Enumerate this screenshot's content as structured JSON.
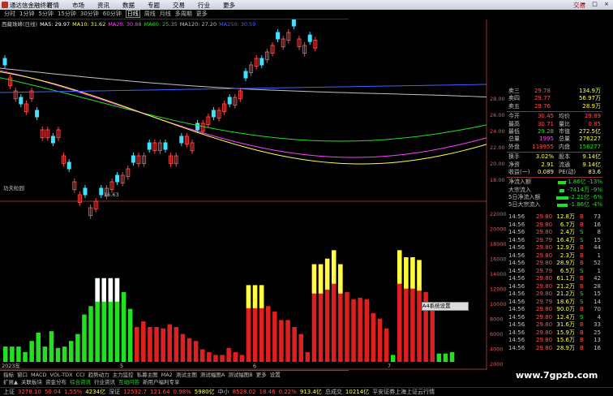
{
  "titlebar": {
    "app_title": "通达信金融终端",
    "menu": [
      "行情",
      "市场",
      "资讯",
      "数据",
      "专题",
      "交易",
      "行业",
      "更多"
    ],
    "brand": "交易",
    "win": "─ □ ×"
  },
  "periods": [
    "分时",
    "1分钟",
    "5分钟",
    "15分钟",
    "30分钟",
    "60分钟",
    "日线",
    "周线",
    "月线",
    "多周期",
    "更多"
  ],
  "active_period": "日线",
  "ma_info": [
    {
      "text": "西藏珠峰(日线)",
      "color": "#c0c0c0"
    },
    {
      "text": "MA5: 29.97",
      "color": "#ffffff"
    },
    {
      "text": "MA10: 31.62",
      "color": "#ffff40"
    },
    {
      "text": "MA20: 30.88",
      "color": "#ff40ff"
    },
    {
      "text": "MA60: 25.35",
      "color": "#20e020"
    },
    {
      "text": "MA120: 27.20",
      "color": "#c0c0c0"
    },
    {
      "text": "MA250: 30.59",
      "color": "#4060ff"
    }
  ],
  "price_axis": [
    "28.00",
    "26.00",
    "24.00",
    "22.00",
    "20.00",
    "18.00"
  ],
  "low_label": "16.63",
  "vol_axis": [
    "22000",
    "20000",
    "18000",
    "16000",
    "14000",
    "12000",
    "10000",
    "8000",
    "6000",
    "4000",
    "2000"
  ],
  "indicator_title": "功夫粒园",
  "date_labels": [
    "2023年",
    "5",
    "6",
    "7"
  ],
  "context_menu": "A4系统设置",
  "quote": {
    "rows_ask": [
      {
        "l": "卖三",
        "v1": "29.78",
        "v2": "134.9万"
      },
      {
        "l": "卖四",
        "v1": "29.77",
        "v2": "56.97万"
      },
      {
        "l": "卖五",
        "v1": "29.76",
        "v2": "28.9万"
      }
    ],
    "stats": [
      {
        "l": "今开",
        "v1": "30.45",
        "c1": "#ff5050",
        "l2": "均价",
        "v2": "29.89",
        "c2": "#ff5050"
      },
      {
        "l": "最高",
        "v1": "30.71",
        "c1": "#ff5050",
        "l2": "量比",
        "v2": "0.85",
        "c2": "#ff5050"
      },
      {
        "l": "最低",
        "v1": "29.28",
        "c1": "#20e020",
        "l2": "市值",
        "v2": "272.5亿",
        "c2": "#ffff40"
      },
      {
        "l": "总量",
        "v1": "1995",
        "c1": "#ff40ff",
        "l2": "总量",
        "v2": "276227",
        "c2": "#ffff40"
      },
      {
        "l": "外盘",
        "v1": "119955",
        "c1": "#ff5050",
        "l2": "内盘",
        "v2": "156277",
        "c2": "#20e020"
      }
    ],
    "stats2": [
      {
        "l": "换手",
        "v1": "3.02%",
        "c1": "#ffff40",
        "l2": "股本",
        "v2": "9.14亿",
        "c2": "#ffff40"
      },
      {
        "l": "净资",
        "v1": "2.91",
        "c1": "#ffff40",
        "l2": "流通",
        "v2": "9.14亿",
        "c2": "#ffff40"
      },
      {
        "l": "收益(一)",
        "v1": "0.089",
        "c1": "#ffff40",
        "l2": "PE(动)",
        "v2": "83.6",
        "c2": "#ffff40"
      }
    ],
    "flows": [
      {
        "l": "净流入额",
        "v2": "-1.86亿",
        "pct": "-13%",
        "bar": 0.2
      },
      {
        "l": "大宗流入",
        "v2": "-7414万",
        "pct": "-9%",
        "bar": 0.05
      },
      {
        "l": "5日净流入额",
        "v2": "-2.21亿",
        "pct": "-6%",
        "bar": 0.35
      },
      {
        "l": "5日大宗流入",
        "v2": "-1.86亿",
        "pct": "-4%",
        "bar": 0.3
      }
    ]
  },
  "ticks": [
    {
      "t": "14:56",
      "p": "29.80",
      "v": "12.8万",
      "bs": "B",
      "n": "73"
    },
    {
      "t": "14:56",
      "p": "29.80",
      "v": "6.7万",
      "bs": "B",
      "n": "16"
    },
    {
      "t": "14:56",
      "p": "29.80",
      "v": "2.4万",
      "bs": "S",
      "n": "8"
    },
    {
      "t": "14:56",
      "p": "29.79",
      "v": "16.4万",
      "bs": "S",
      "n": "15"
    },
    {
      "t": "14:56",
      "p": "29.80",
      "v": "12.9万",
      "bs": "B",
      "n": "44"
    },
    {
      "t": "14:56",
      "p": "29.80",
      "v": "2.3万",
      "bs": "B",
      "n": "1"
    },
    {
      "t": "14:56",
      "p": "29.80",
      "v": "28.9万",
      "bs": "B",
      "n": "52"
    },
    {
      "t": "14:56",
      "p": "29.79",
      "v": "6.5万",
      "bs": "S",
      "n": "1"
    },
    {
      "t": "14:56",
      "p": "29.80",
      "v": "61.1万",
      "bs": "B",
      "n": "42"
    },
    {
      "t": "14:56",
      "p": "29.80",
      "v": "21.2万",
      "bs": "B",
      "n": "28"
    },
    {
      "t": "14:56",
      "p": "29.80",
      "v": "21.2万",
      "bs": "S",
      "n": "15"
    },
    {
      "t": "14:56",
      "p": "29.79",
      "v": "18.6万",
      "bs": "S",
      "n": "14"
    },
    {
      "t": "14:56",
      "p": "29.80",
      "v": "90.0万",
      "bs": "B",
      "n": "70"
    },
    {
      "t": "14:56",
      "p": "29.80",
      "v": "12.4万",
      "bs": "S",
      "n": "4"
    },
    {
      "t": "14:56",
      "p": "29.80",
      "v": "31.6万",
      "bs": "B",
      "n": "33"
    },
    {
      "t": "14:56",
      "p": "29.80",
      "v": "15.9万",
      "bs": "B",
      "n": "25"
    },
    {
      "t": "14:56",
      "p": "29.80",
      "v": "15.6万",
      "bs": "B",
      "n": "13"
    },
    {
      "t": "14:56",
      "p": "29.80",
      "v": "28.9万",
      "bs": "B",
      "n": "16"
    }
  ],
  "bottom_tabs": [
    "指标",
    "窗口",
    "MACD",
    "VOL-TDX",
    "CCI",
    "趋势动力",
    "主力监控",
    "私募主图",
    "MA2",
    "测试主图",
    "测试幅图A",
    "测试幅图B",
    "更多",
    "设置"
  ],
  "func_tabs": [
    "扩展▲",
    "关联板块",
    "资金分布",
    "综合资讯",
    "行业资讯",
    "互动问答",
    "新用户福利专享"
  ],
  "status": [
    {
      "text": "上证",
      "c": "#c0c0c0"
    },
    {
      "text": "3278.10",
      "c": "#ff5050"
    },
    {
      "text": "50.04",
      "c": "#ff5050"
    },
    {
      "text": "1.55%",
      "c": "#ff5050"
    },
    {
      "text": "4234亿",
      "c": "#ffff40"
    },
    {
      "text": "深证",
      "c": "#c0c0c0"
    },
    {
      "text": "12532.7",
      "c": "#ff5050"
    },
    {
      "text": "121.64",
      "c": "#ff5050"
    },
    {
      "text": "0.98%",
      "c": "#ff5050"
    },
    {
      "text": "5980亿",
      "c": "#ffff40"
    },
    {
      "text": "中小",
      "c": "#c0c0c0"
    },
    {
      "text": "8528.02",
      "c": "#ff5050"
    },
    {
      "text": "18.46",
      "c": "#ff5050"
    },
    {
      "text": "0.22%",
      "c": "#ff5050"
    },
    {
      "text": "913.4亿",
      "c": "#ffff40"
    },
    {
      "text": "总成交",
      "c": "#c0c0c0"
    },
    {
      "text": "10214亿",
      "c": "#ffff40"
    },
    {
      "text": "平安证券上海上证云行情",
      "c": "#c0c0c0"
    }
  ],
  "watermark": "www.7gpzb.com"
}
